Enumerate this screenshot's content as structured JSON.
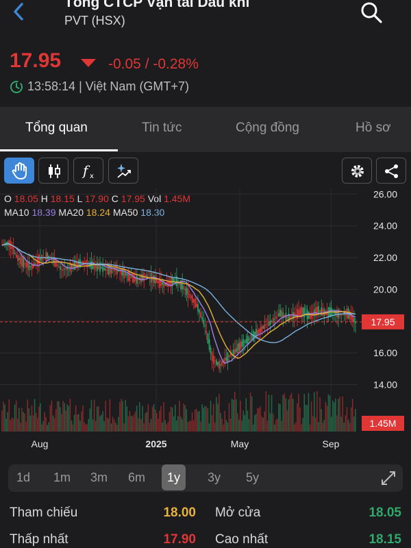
{
  "header": {
    "title": "Tổng CTCP Vận tải Dầu khí",
    "subtitle": "PVT (HSX)"
  },
  "quote": {
    "price": "17.95",
    "change": "-0.05 / -0.28%",
    "time": "13:58:14 | Việt Nam (GMT+7)"
  },
  "tabs": [
    {
      "label": "Tổng quan"
    },
    {
      "label": "Tin tức"
    },
    {
      "label": "Cộng đồng"
    },
    {
      "label": "Hồ sơ"
    }
  ],
  "legend": {
    "o_label": "O",
    "o": "18.05",
    "h_label": "H",
    "h": "18.15",
    "l_label": "L",
    "l": "17.90",
    "c_label": "C",
    "c": "17.95",
    "vol_label": "Vol",
    "vol": "1.45M",
    "ma10_label": "MA10",
    "ma10": "18.39",
    "ma20_label": "MA20",
    "ma20": "18.24",
    "ma50_label": "MA50",
    "ma50": "18.30"
  },
  "chart_data": {
    "type": "candlestick",
    "y_ticks": [
      "26.00",
      "24.00",
      "22.00",
      "20.00",
      "18.00",
      "16.00",
      "14.00"
    ],
    "ylim": [
      13.2,
      26.4
    ],
    "x_ticks": [
      "Aug",
      "2025",
      "May",
      "Sep"
    ],
    "last_price_tag": "17.95",
    "volume_tag": "1.45M",
    "close_approx": [
      22.8,
      22.9,
      22.0,
      21.6,
      21.4,
      21.9,
      22.1,
      21.7,
      21.2,
      21.4,
      21.6,
      21.7,
      21.5,
      21.4,
      21.2,
      21.3,
      21.1,
      20.8,
      20.6,
      20.8,
      20.7,
      20.4,
      20.3,
      20.6,
      20.2,
      19.6,
      18.9,
      17.7,
      15.6,
      15.2,
      15.7,
      16.1,
      16.6,
      16.9,
      17.3,
      17.7,
      18.0,
      18.5,
      18.2,
      18.4,
      18.6,
      18.3,
      18.7,
      18.5,
      18.6,
      18.4,
      18.5,
      17.95
    ]
  },
  "ranges": [
    {
      "label": "1d"
    },
    {
      "label": "1m"
    },
    {
      "label": "3m"
    },
    {
      "label": "6m"
    },
    {
      "label": "1y"
    },
    {
      "label": "3y"
    },
    {
      "label": "5y"
    }
  ],
  "stats": {
    "ref_label": "Tham chiếu",
    "ref_value": "18.00",
    "open_label": "Mở cửa",
    "open_value": "18.05",
    "low_label": "Thấp nhất",
    "low_value": "17.90",
    "high_label": "Cao nhất",
    "high_value": "18.15"
  },
  "colors": {
    "up": "#2ea86b",
    "down": "#e03636",
    "ref": "#e9b23c",
    "accent": "#3e86d8"
  }
}
